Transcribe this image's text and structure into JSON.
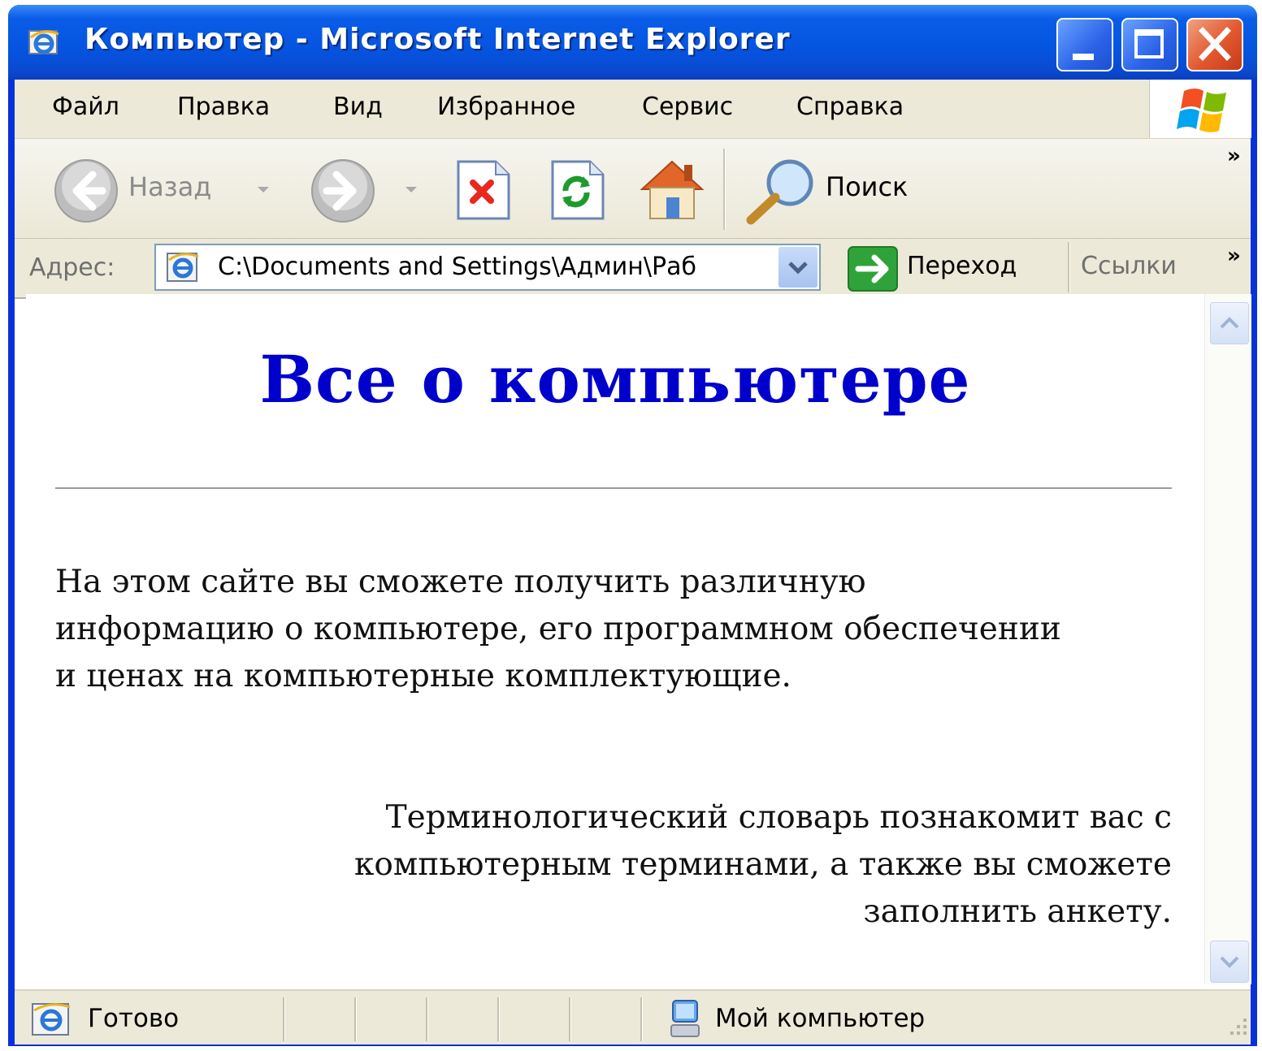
{
  "window": {
    "title": "Компьютер - Microsoft Internet Explorer"
  },
  "menu": {
    "items": [
      "Файл",
      "Правка",
      "Вид",
      "Избранное",
      "Сервис",
      "Справка"
    ]
  },
  "toolbar": {
    "back_label": "Назад",
    "search_label": "Поиск",
    "overflow": "»"
  },
  "address": {
    "label": "Адрес:",
    "value": "C:\\Documents and Settings\\Админ\\Раб",
    "go_label": "Переход",
    "links_label": "Ссылки",
    "overflow": "»"
  },
  "page": {
    "heading": "Все о компьютере",
    "paragraph1": "На этом сайте вы сможете получить различную информацию о компьютере, его программном обеспечении и ценах на компьютерные комплектующие.",
    "paragraph2": "Терминологический словарь познакомит вас с компьютерным терминами, а также вы сможете заполнить анкету.",
    "heading_color": "#0000cc"
  },
  "status": {
    "text": "Готово",
    "zone": "Мой компьютер"
  },
  "colors": {
    "titlebar": "#0554e0",
    "chrome": "#ece9d8",
    "close_button": "#e2582e"
  }
}
